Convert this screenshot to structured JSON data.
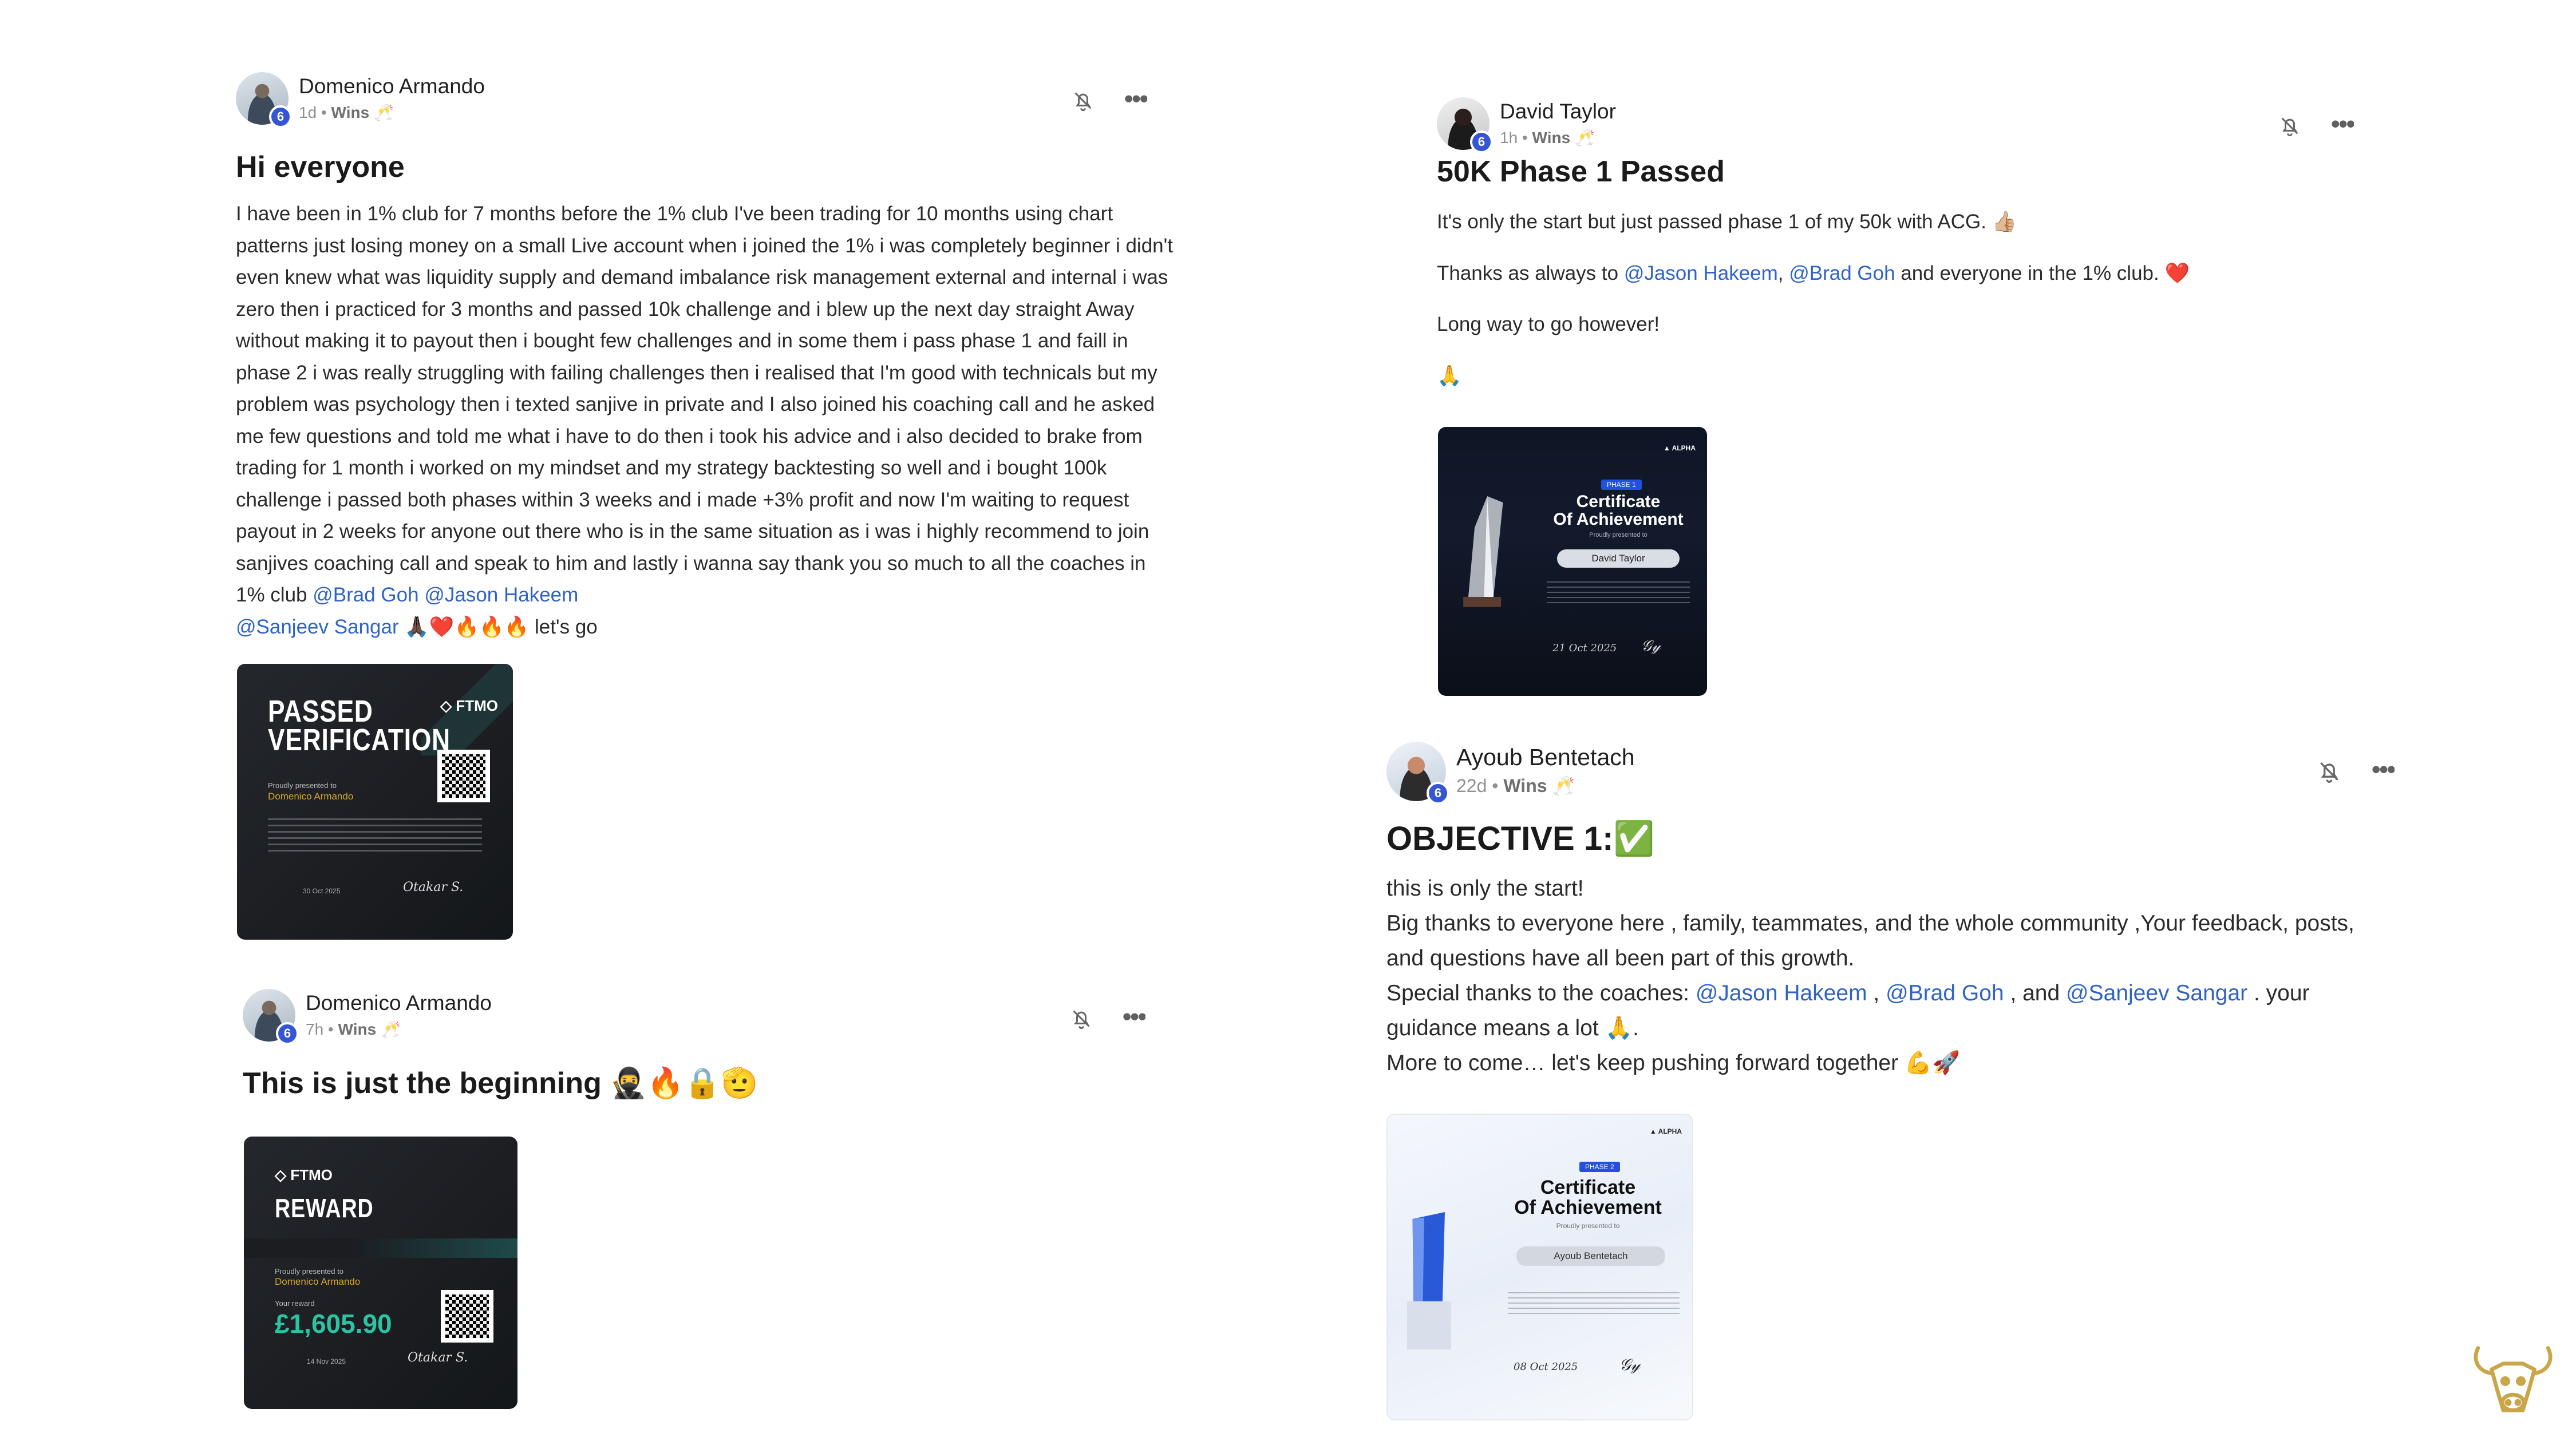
{
  "posts": [
    {
      "author": "Domenico Armando",
      "level": "6",
      "time": "1d",
      "category": "Wins",
      "category_emoji": "🥂",
      "title": "Hi everyone",
      "body": "I have been in 1% club for 7 months before the 1% club I've been trading for 10 months using chart patterns just losing money on a small Live account when i joined the 1% i was completely beginner i didn't even knew what was liquidity supply and demand imbalance risk management external and internal i was zero then i practiced for 3 months and passed 10k challenge and i blew up the next day straight Away without making it to payout then i bought few challenges and in some them i pass phase 1 and faill in phase 2 i was really struggling with failing challenges then i realised that I'm good with technicals but my problem was psychology then i texted sanjive in private and I also joined his coaching call and he asked me few questions and told me what i have to do then i took his advice and i also decided to brake from trading for 1 month i worked on my mindset and my strategy backtesting so well and i bought 100k challenge i passed both phases within 3 weeks and i made +3% profit and now I'm waiting to request payout in 2 weeks for anyone out there who is in the same situation as i was i highly recommend to join sanjives coaching call and speak to him and lastly i wanna say thank you so much to all the coaches in 1% club ",
      "mentions": [
        "@Brad Goh",
        "@Jason Hakeem",
        "@Sanjeev Sangar"
      ],
      "body_end": " 🙏🏿❤️🔥🔥🔥 let's go",
      "image": {
        "heading": "PASSED VERIFICATION",
        "brand": "FTMO",
        "presented": "Proudly presented to",
        "name": "Domenico Armando",
        "date": "30 Oct 2025",
        "signature": "Otakar S."
      }
    },
    {
      "author": "Domenico Armando",
      "level": "6",
      "time": "7h",
      "category": "Wins",
      "category_emoji": "🥂",
      "title": "This is just the beginning 🥷🔥🔒🫡",
      "image": {
        "brand": "FTMO",
        "heading": "REWARD",
        "presented": "Proudly presented to",
        "name": "Domenico Armando",
        "reward_label": "Your reward",
        "amount": "£1,605.90",
        "date": "14 Nov 2025",
        "signature": "Otakar S."
      }
    },
    {
      "author": "David Taylor",
      "level": "6",
      "time": "1h",
      "category": "Wins",
      "category_emoji": "🥂",
      "title": "50K Phase 1 Passed",
      "line1": "It's only the start but just passed phase 1 of my 50k with ACG. 👍🏼",
      "line2_pre": "Thanks as always to ",
      "line2_m1": "@Jason Hakeem",
      "line2_sep": ", ",
      "line2_m2": "@Brad Goh",
      "line2_post": " and everyone in the 1% club. ❤️",
      "line3": "Long way to go however!",
      "line4": "🙏",
      "image": {
        "badge": "PHASE 1",
        "heading1": "Certificate",
        "heading2": "Of Achievement",
        "presented": "Proudly presented to",
        "name": "David Taylor",
        "date": "21 Oct 2025",
        "brand": "ALPHA"
      }
    },
    {
      "author": "Ayoub Bentetach",
      "level": "6",
      "time": "22d",
      "category": "Wins",
      "category_emoji": "🥂",
      "title": "OBJECTIVE 1:✅",
      "line1": "this is only the start!",
      "line2": "Big thanks to everyone here , family, teammates, and the whole community ,Your feedback, posts, and questions have all been part of this growth.",
      "line3_pre": "Special thanks to the coaches: ",
      "line3_m1": "@Jason Hakeem",
      "line3_sep1": " , ",
      "line3_m2": "@Brad Goh",
      "line3_sep2": " , and ",
      "line3_m3": "@Sanjeev Sangar",
      "line3_post": " . your guidance means a lot 🙏.",
      "line4": "More to come… let's keep pushing forward together 💪🚀",
      "image": {
        "badge": "PHASE 2",
        "heading1": "Certificate",
        "heading2": "Of Achievement",
        "presented": "Proudly presented to",
        "name": "Ayoub Bentetach",
        "date": "08 Oct 2025",
        "brand": "ALPHA"
      }
    }
  ],
  "icons": {
    "bell": "bell-off-icon",
    "more": "more-horizontal-icon",
    "mascot": "bull-logo-icon"
  },
  "colors": {
    "mention": "#2f63c7",
    "level_badge": "#3556d4",
    "mascot_gold": "#c9a64a"
  }
}
